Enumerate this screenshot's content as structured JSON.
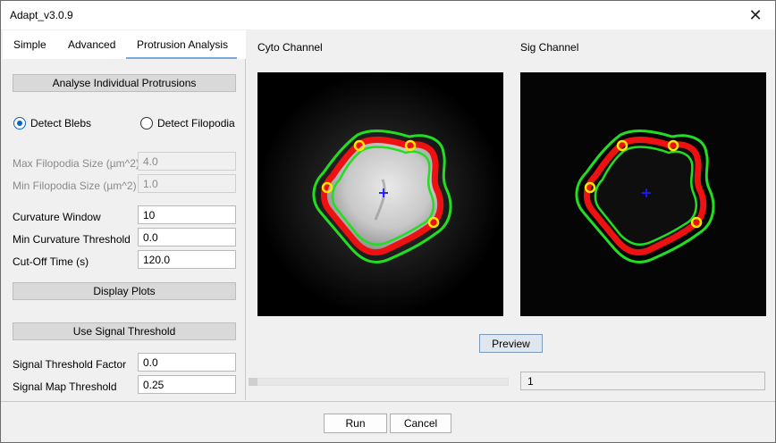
{
  "window": {
    "title": "Adapt_v3.0.9"
  },
  "tabs": [
    {
      "label": "Simple"
    },
    {
      "label": "Advanced"
    },
    {
      "label": "Protrusion Analysis",
      "active": true
    }
  ],
  "protrusion": {
    "analyse_button": "Analyse Individual Protrusions",
    "radio_blebs": "Detect Blebs",
    "radio_filopodia": "Detect Filopodia",
    "selected_mode": "Detect Blebs",
    "max_filopodia_label": "Max Filopodia Size (µm^2)",
    "max_filopodia_value": "4.0",
    "min_filopodia_label": "Min Filopodia Size (µm^2)",
    "min_filopodia_value": "1.0",
    "curvature_window_label": "Curvature Window",
    "curvature_window_value": "10",
    "min_curvature_label": "Min Curvature Threshold",
    "min_curvature_value": "0.0",
    "cutoff_label": "Cut-Off Time (s)",
    "cutoff_value": "120.0",
    "display_plots_button": "Display Plots",
    "signal_threshold_button": "Use Signal Threshold",
    "signal_factor_label": "Signal Threshold Factor",
    "signal_factor_value": "0.0",
    "signal_map_label": "Signal Map Threshold",
    "signal_map_value": "0.25"
  },
  "preview": {
    "cyto_label": "Cyto Channel",
    "sig_label": "Sig Channel",
    "preview_button": "Preview",
    "frame_value": "1"
  },
  "footer": {
    "run_button": "Run",
    "cancel_button": "Cancel"
  },
  "colors": {
    "contour_green": "#22dd22",
    "contour_red": "#ee1111",
    "marker_yellow": "#ffe600",
    "center_blue": "#1a1aff",
    "accent": "#0a64c8"
  },
  "icons": {
    "close": "close-icon"
  }
}
